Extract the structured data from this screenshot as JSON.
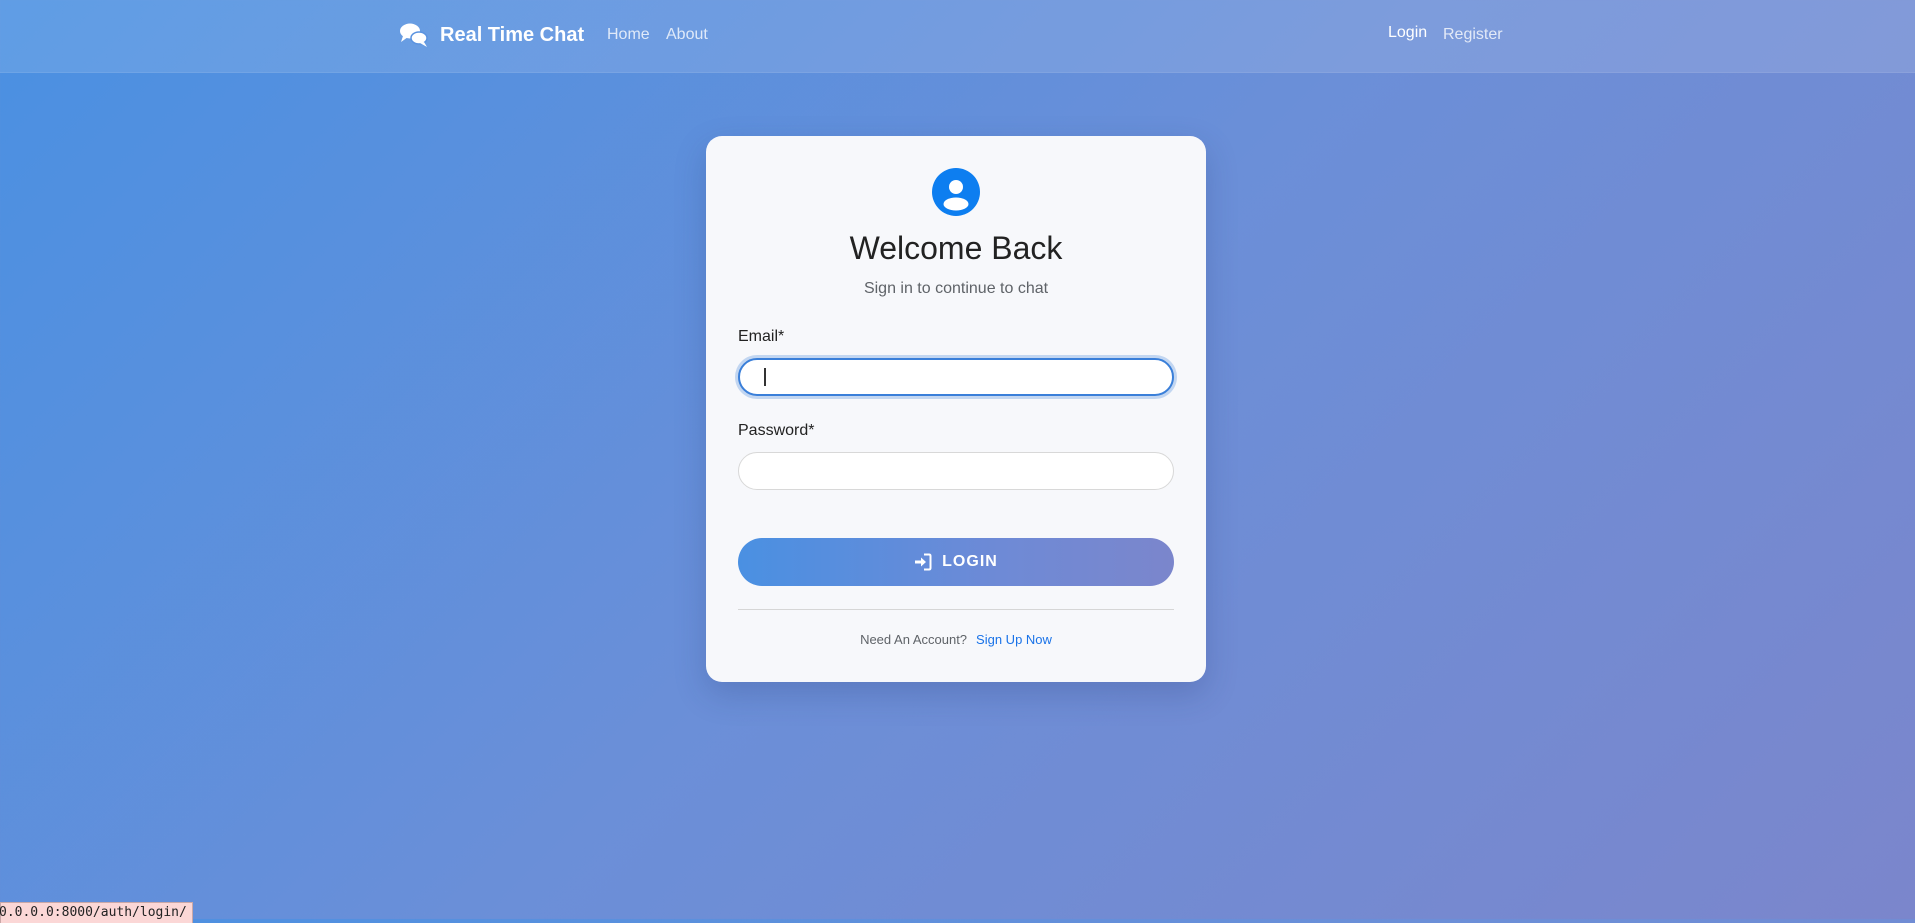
{
  "nav": {
    "brand": "Real Time Chat",
    "brand_icon": "chat-bubbles-icon",
    "links": [
      "Home",
      "About"
    ],
    "auth_links": [
      "Login",
      "Register"
    ]
  },
  "card": {
    "avatar_icon": "user-circle-icon",
    "title": "Welcome Back",
    "subtitle": "Sign in to continue to chat",
    "email": {
      "label": "Email*",
      "value": "",
      "placeholder": ""
    },
    "password": {
      "label": "Password*",
      "value": "",
      "placeholder": ""
    },
    "login_button": {
      "label": "LOGIN",
      "icon": "sign-in-icon"
    },
    "footer": {
      "text": "Need An Account?",
      "link": "Sign Up Now"
    }
  },
  "status_bar": {
    "url": "0.0.0.0:8000/auth/login/"
  },
  "colors": {
    "accent": "#4a90e2",
    "link": "#1a73e8",
    "avatar": "#0d7ef0"
  }
}
